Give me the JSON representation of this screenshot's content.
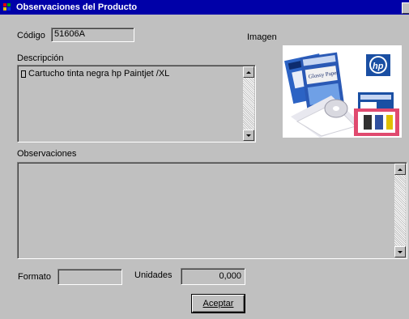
{
  "window": {
    "title": "Observaciones del Producto",
    "icon": "app-icon"
  },
  "codigo": {
    "label": "Código",
    "value": "51606A"
  },
  "imagen": {
    "label": "Imagen",
    "description_icon": "product-photo"
  },
  "descripcion": {
    "label": "Descripción",
    "value": "Cartucho tinta negra hp Paintjet /XL"
  },
  "observaciones": {
    "label": "Observaciones",
    "value": ""
  },
  "formato": {
    "label": "Formato",
    "value": ""
  },
  "unidades": {
    "label": "Unidades",
    "value": "0,000"
  },
  "accept_button": {
    "label": "Aceptar"
  },
  "colors": {
    "title_bar": "#0000a8",
    "face": "#c0c0c0",
    "brand_blue": "#1a4fa3"
  }
}
